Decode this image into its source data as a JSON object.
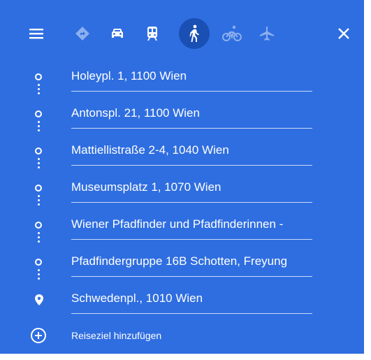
{
  "colors": {
    "panel_bg": "#2f6ee0",
    "active_mode_bg": "#1a4fb4",
    "text": "#ffffff"
  },
  "toolbar": {
    "menu_icon": "hamburger-menu-icon",
    "modes": [
      {
        "icon": "directions-diamond-icon",
        "active": false
      },
      {
        "icon": "car-icon",
        "active": false
      },
      {
        "icon": "transit-icon",
        "active": false
      },
      {
        "icon": "walking-icon",
        "active": true
      },
      {
        "icon": "bicycle-icon",
        "active": false
      },
      {
        "icon": "airplane-icon",
        "active": false
      }
    ],
    "close_icon": "close-icon"
  },
  "stops": [
    {
      "label": "Holeypl. 1, 1100 Wien",
      "marker": "circle"
    },
    {
      "label": "Antonspl. 21, 1100 Wien",
      "marker": "circle"
    },
    {
      "label": "Mattiellistraße 2-4, 1040 Wien",
      "marker": "circle"
    },
    {
      "label": "Museumsplatz 1, 1070 Wien",
      "marker": "circle"
    },
    {
      "label": "Wiener Pfadfinder und Pfadfinderinnen -",
      "marker": "circle"
    },
    {
      "label": "Pfadfindergruppe 16B Schotten, Freyung",
      "marker": "circle"
    },
    {
      "label": "Schwedenpl., 1010 Wien",
      "marker": "pin"
    }
  ],
  "add_destination": {
    "label": "Reiseziel hinzufügen",
    "icon": "add-circle-icon"
  }
}
